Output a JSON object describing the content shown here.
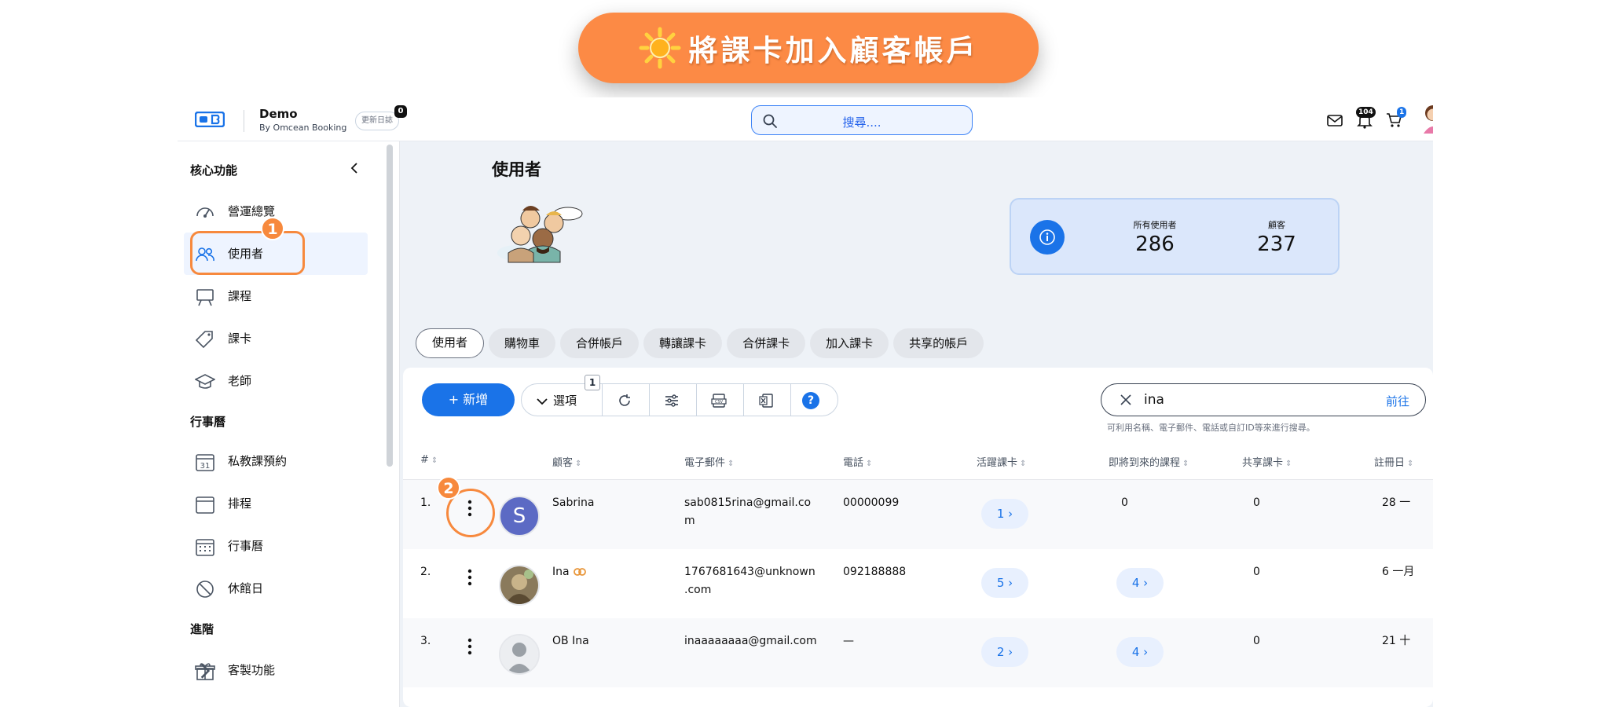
{
  "banner": {
    "text": "將課卡加入顧客帳戶"
  },
  "topbar": {
    "brand_name": "Demo",
    "brand_sub": "By Omcean Booking",
    "changelog_label": "更新日誌",
    "changelog_count": "0",
    "search_placeholder": "搜尋....",
    "notif_count": "104",
    "cart_count": "1"
  },
  "sidebar": {
    "sections": {
      "core": "核心功能",
      "calendar": "行事曆",
      "advanced": "進階"
    },
    "core_items": [
      {
        "label": "營運總覽"
      },
      {
        "label": "使用者"
      },
      {
        "label": "課程"
      },
      {
        "label": "課卡"
      },
      {
        "label": "老師"
      }
    ],
    "calendar_items": [
      {
        "label": "私教課預約"
      },
      {
        "label": "排程"
      },
      {
        "label": "行事曆"
      },
      {
        "label": "休館日"
      }
    ],
    "advanced_items": [
      {
        "label": "客製功能"
      }
    ]
  },
  "main": {
    "title": "使用者",
    "stats": {
      "all_users_label": "所有使用者",
      "all_users_value": "286",
      "customers_label": "顧客",
      "customers_value": "237"
    },
    "tabs": [
      {
        "label": "使用者"
      },
      {
        "label": "購物車"
      },
      {
        "label": "合併帳戶"
      },
      {
        "label": "轉讓課卡"
      },
      {
        "label": "合併課卡"
      },
      {
        "label": "加入課卡"
      },
      {
        "label": "共享的帳戶"
      }
    ],
    "toolbar": {
      "add_label": "+ 新增",
      "options_label": "選項",
      "options_badge": "1",
      "help_label": "?"
    },
    "table_search": {
      "value": "ina",
      "go_label": "前往",
      "hint": "可利用名稱、電子郵件、電話或自訂ID等來進行搜尋。"
    },
    "columns": [
      "#",
      "顧客",
      "電子郵件",
      "電話",
      "活躍課卡",
      "即將到來的課程",
      "共享課卡",
      "註冊日"
    ],
    "rows": [
      {
        "num": "1.",
        "avatar_letter": "S",
        "name": "Sabrina",
        "email_1": "sab0815rina@gmail.co",
        "email_2": "m",
        "phone": "00000099",
        "active_cards": "1 ›",
        "upcoming": "0",
        "shared": "0",
        "registered": "28 一"
      },
      {
        "num": "2.",
        "name": "Ina",
        "email_1": "1767681643@unknown",
        "email_2": ".com",
        "phone": "092188888",
        "active_cards": "5 ›",
        "upcoming": "4 ›",
        "shared": "0",
        "registered": "6 一月"
      },
      {
        "num": "3.",
        "name": "OB Ina",
        "email_1": "inaaaaaaaa@gmail.com",
        "email_2": "",
        "phone": "—",
        "active_cards": "2 ›",
        "upcoming": "4 ›",
        "shared": "0",
        "registered": "21 十"
      }
    ]
  },
  "annotations": [
    {
      "label": "1"
    },
    {
      "label": "2"
    }
  ]
}
